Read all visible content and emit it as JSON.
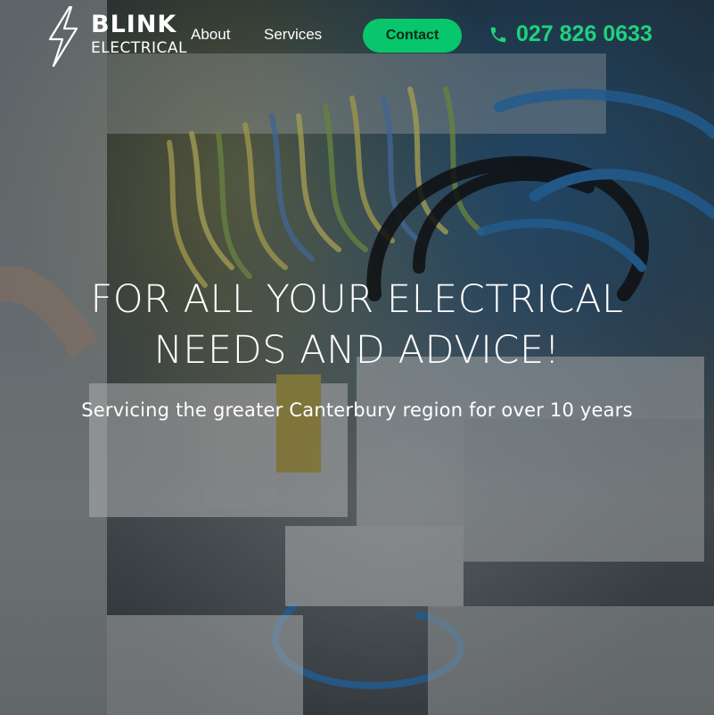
{
  "brand": {
    "name": "BLINK",
    "sub": "ELECTRICAL"
  },
  "nav": {
    "about": "About",
    "services": "Services"
  },
  "contact_label": "Contact",
  "phone": "027 826 0633",
  "hero": {
    "headline_line1": "FOR ALL YOUR ELECTRICAL",
    "headline_line2": "NEEDS AND ADVICE!",
    "subline": "Servicing the greater Canterbury region for over 10 years"
  },
  "colors": {
    "accent": "#08c66b",
    "phone": "#1fd27b"
  },
  "icons": {
    "logo": "lightning-bolt-icon",
    "phone": "phone-icon"
  }
}
